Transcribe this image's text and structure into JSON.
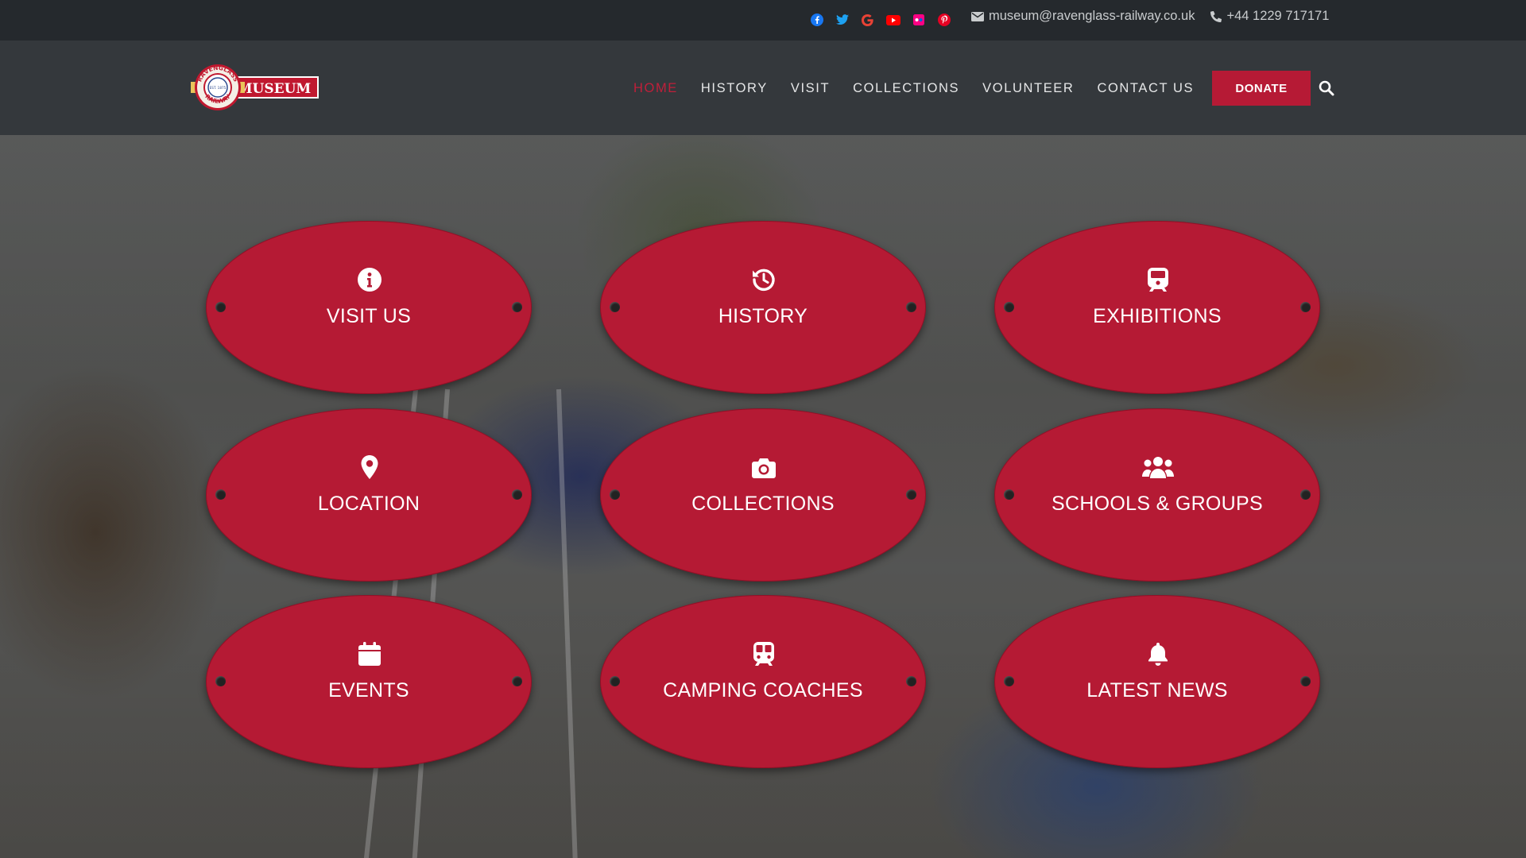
{
  "topbar": {
    "social_icons": [
      "facebook-icon",
      "twitter-icon",
      "google-icon",
      "youtube-icon",
      "flickr-icon",
      "pinterest-icon"
    ],
    "email": "museum@ravenglass-railway.co.uk",
    "phone": "+44 1229 717171"
  },
  "header": {
    "logo": {
      "ring_top": "RAVENGLASS",
      "ring_bottom": "RAILWAY",
      "centre": "EST. 1875",
      "word": "MUSEUM"
    },
    "nav": [
      {
        "label": "HOME",
        "active": true
      },
      {
        "label": "HISTORY"
      },
      {
        "label": "VISIT"
      },
      {
        "label": "COLLECTIONS"
      },
      {
        "label": "VOLUNTEER"
      },
      {
        "label": "CONTACT US"
      }
    ],
    "donate": "DONATE"
  },
  "tiles": [
    {
      "label": "VISIT US",
      "icon": "info-icon"
    },
    {
      "label": "HISTORY",
      "icon": "history-icon"
    },
    {
      "label": "EXHIBITIONS",
      "icon": "train-icon"
    },
    {
      "label": "LOCATION",
      "icon": "map-pin-icon"
    },
    {
      "label": "COLLECTIONS",
      "icon": "camera-icon"
    },
    {
      "label": "SCHOOLS & GROUPS",
      "icon": "users-icon"
    },
    {
      "label": "EVENTS",
      "icon": "calendar-icon"
    },
    {
      "label": "CAMPING COACHES",
      "icon": "subway-icon"
    },
    {
      "label": "LATEST NEWS",
      "icon": "bell-icon"
    }
  ],
  "colors": {
    "accent": "#b51a34",
    "topbar": "#25292d",
    "header": "#34383c"
  }
}
